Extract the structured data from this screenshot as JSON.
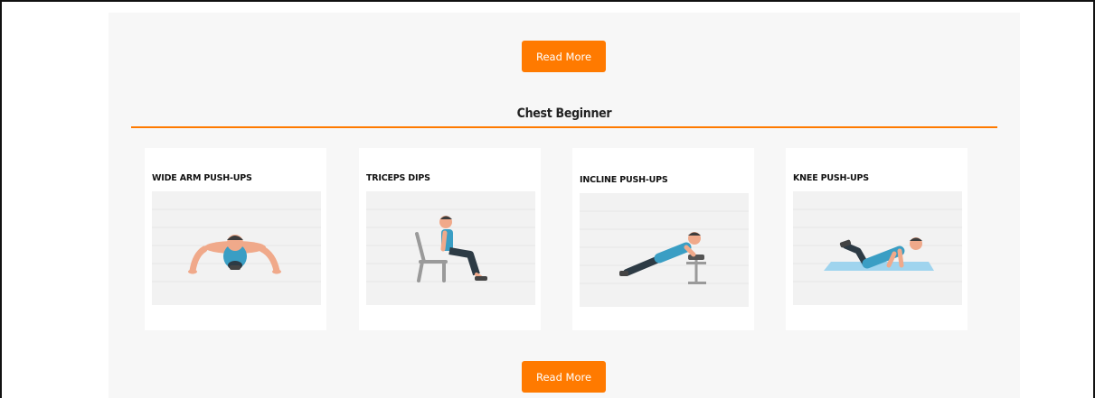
{
  "buttons": {
    "read_more_top": "Read More",
    "read_more_bottom": "Read More"
  },
  "section": {
    "title": "Chest Beginner"
  },
  "exercises": [
    {
      "title": "WIDE ARM PUSH-UPS",
      "icon": "wide-arm-pushup-illustration"
    },
    {
      "title": "TRICEPS DIPS",
      "icon": "triceps-dips-illustration"
    },
    {
      "title": "INCLINE PUSH-UPS",
      "icon": "incline-pushup-illustration"
    },
    {
      "title": "KNEE PUSH-UPS",
      "icon": "knee-pushup-illustration"
    }
  ],
  "colors": {
    "accent": "#ff7a00",
    "panel_bg": "#f7f7f7",
    "card_bg": "#ffffff",
    "shirt": "#3a9ec4",
    "skin": "#f0a98a",
    "mat": "#9fd4ee"
  }
}
